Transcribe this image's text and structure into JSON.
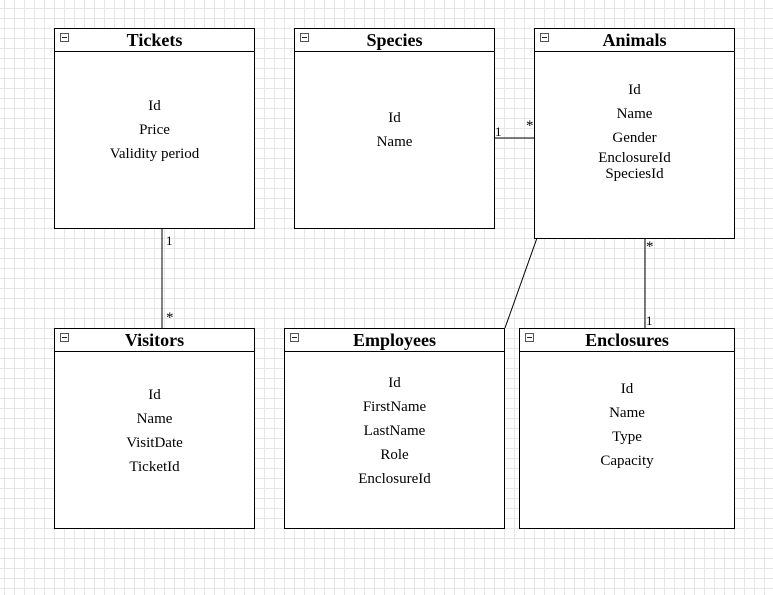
{
  "entities": {
    "tickets": {
      "title": "Tickets",
      "fields": [
        "Id",
        "Price",
        "Validity period"
      ]
    },
    "species": {
      "title": "Species",
      "fields": [
        "Id",
        "Name"
      ]
    },
    "animals": {
      "title": "Animals",
      "fields": [
        "Id",
        "Name",
        "Gender",
        "EnclosureId",
        "SpeciesId"
      ]
    },
    "visitors": {
      "title": "Visitors",
      "fields": [
        "Id",
        "Name",
        "VisitDate",
        "TicketId"
      ]
    },
    "employees": {
      "title": "Employees",
      "fields": [
        "Id",
        "FirstName",
        "LastName",
        "Role",
        "EnclosureId"
      ]
    },
    "enclosures": {
      "title": "Enclosures",
      "fields": [
        "Id",
        "Name",
        "Type",
        "Capacity"
      ]
    }
  },
  "relationships": [
    {
      "from": "tickets",
      "to": "visitors",
      "from_mult": "1",
      "to_mult": "*"
    },
    {
      "from": "species",
      "to": "animals",
      "from_mult": "1",
      "to_mult": "*"
    },
    {
      "from": "animals",
      "to": "employees",
      "from_mult": "*",
      "to_mult": "*"
    },
    {
      "from": "animals",
      "to": "enclosures",
      "from_mult": "*",
      "to_mult": "1"
    }
  ]
}
